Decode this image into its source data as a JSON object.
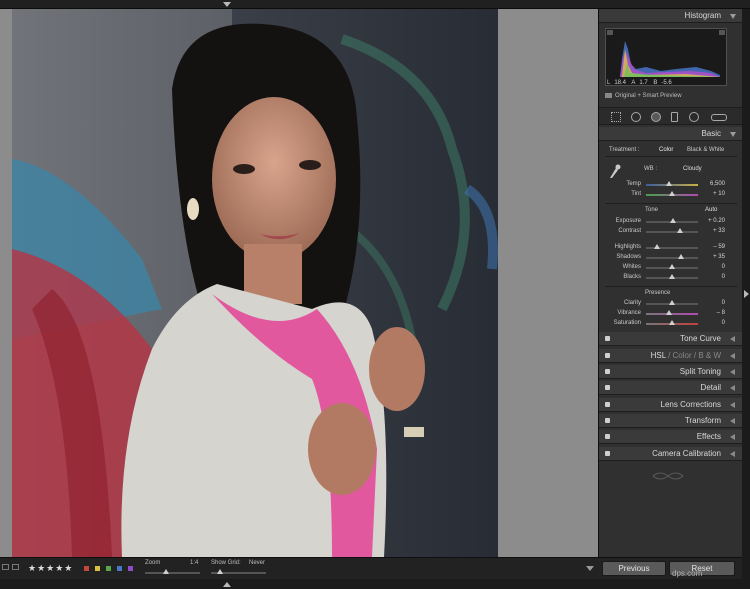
{
  "panel": {
    "histogram_title": "Histogram",
    "readout": {
      "L": "L",
      "L_val": "18.4",
      "A": "A",
      "A_val": "1.7",
      "B": "B",
      "B_val": "-5.6"
    },
    "preview_status": "Original + Smart Preview",
    "basic_title": "Basic",
    "treatment_label": "Treatment :",
    "treatment_color": "Color",
    "treatment_bw": "Black & White",
    "wb_label": "WB :",
    "wb_value": "Cloudy",
    "temp_label": "Temp",
    "temp_value": "6,500",
    "tint_label": "Tint",
    "tint_value": "+ 10",
    "tone_label": "Tone",
    "auto_label": "Auto",
    "exposure_label": "Exposure",
    "exposure_value": "+ 0.20",
    "contrast_label": "Contrast",
    "contrast_value": "+ 33",
    "highlights_label": "Highlights",
    "highlights_value": "– 59",
    "shadows_label": "Shadows",
    "shadows_value": "+ 35",
    "whites_label": "Whites",
    "whites_value": "0",
    "blacks_label": "Blacks",
    "blacks_value": "0",
    "presence_label": "Presence",
    "clarity_label": "Clarity",
    "clarity_value": "0",
    "vibrance_label": "Vibrance",
    "vibrance_value": "– 8",
    "saturation_label": "Saturation",
    "saturation_value": "0",
    "sections": {
      "tone_curve": "Tone Curve",
      "hsl": "HSL",
      "color": "Color",
      "bw": "B & W",
      "split_toning": "Split Toning",
      "detail": "Detail",
      "lens_corrections": "Lens Corrections",
      "transform": "Transform",
      "effects": "Effects",
      "camera_calibration": "Camera Calibration"
    },
    "previous_button": "Previous",
    "reset_button": "Reset"
  },
  "toolbar": {
    "zoom_label": "Zoom",
    "zoom_value": "1:4",
    "show_grid_label": "Show Grid:",
    "show_grid_value": "Never",
    "rating_stars": "★★★★★"
  },
  "flag_colors": [
    "#c9463d",
    "#d6c13a",
    "#58a84a",
    "#4a78c9",
    "#8a4fc4"
  ],
  "watermark": "dps.com"
}
